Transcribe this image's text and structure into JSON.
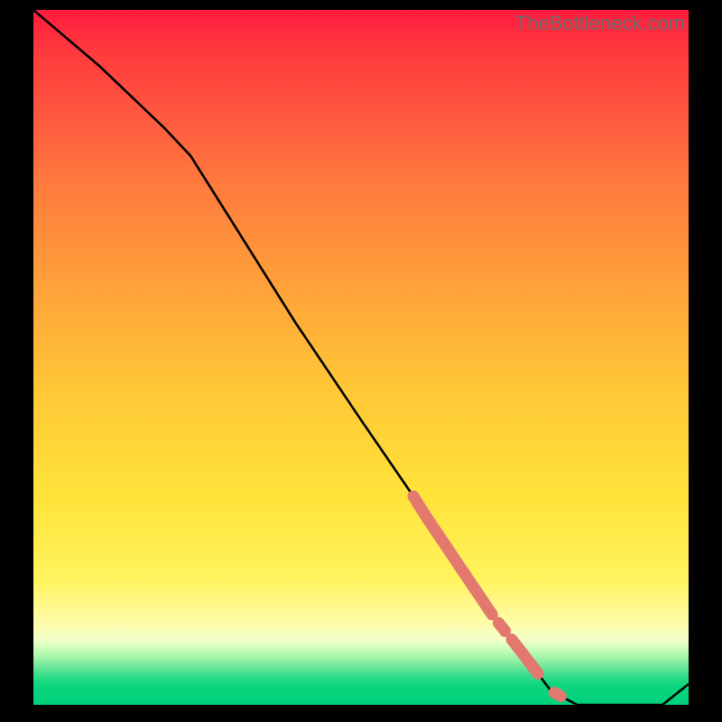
{
  "watermark": "TheBottleneck.com",
  "colors": {
    "curve": "#000000",
    "highlight": "#e2786e",
    "background_top": "#ff1b3f",
    "background_bottom": "#00d07a"
  },
  "chart_data": {
    "type": "line",
    "title": "",
    "xlabel": "",
    "ylabel": "",
    "xlim": [
      0,
      100
    ],
    "ylim": [
      0,
      100
    ],
    "grid": false,
    "legend": false,
    "series": [
      {
        "name": "bottleneck-curve",
        "x": [
          0,
          10,
          20,
          24,
          30,
          40,
          50,
          58,
          60,
          65,
          70,
          75,
          79,
          83,
          90,
          96,
          100
        ],
        "y": [
          100,
          92,
          83,
          79,
          70,
          55,
          41,
          30,
          27,
          20,
          13,
          7,
          2,
          0,
          0,
          0,
          3
        ]
      }
    ],
    "highlights": [
      {
        "name": "segment-1",
        "x_start": 58,
        "x_end": 70,
        "thickness": "thick"
      },
      {
        "name": "dot-1",
        "x_start": 71,
        "x_end": 72,
        "thickness": "thick"
      },
      {
        "name": "segment-2",
        "x_start": 73,
        "x_end": 77,
        "thickness": "thick"
      },
      {
        "name": "dot-2",
        "x_start": 79.5,
        "x_end": 80.5,
        "thickness": "thick"
      }
    ]
  }
}
